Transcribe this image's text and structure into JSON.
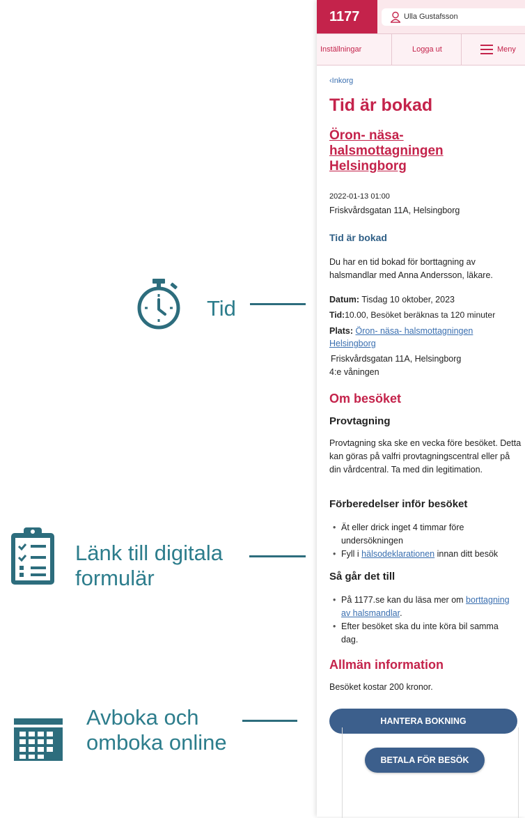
{
  "annotations": [
    {
      "label": "Tid",
      "icon": "stopwatch-icon"
    },
    {
      "label_line1": "Länk till digitala",
      "label_line2": "formulär",
      "icon": "clipboard-checklist-icon"
    },
    {
      "label_line1": "Avboka och",
      "label_line2": "omboka online",
      "icon": "calendar-icon"
    }
  ],
  "header": {
    "logo": "1177",
    "user_name": "Ulla Gustafsson",
    "nav": {
      "settings": "Inställningar",
      "logout": "Logga ut",
      "menu": "Meny"
    }
  },
  "message": {
    "back_link": "Inkorg",
    "title": "Tid är bokad",
    "clinic_name": "Öron- näsa- halsmottagningen Helsingborg",
    "datetime": "2022-01-13 01:00",
    "address": "Friskvårdsgatan 11A, Helsingborg",
    "subheading": "Tid är bokad",
    "intro": "Du har en tid bokad för borttagning av halsmandlar med Anna Andersson, läkare.",
    "date_label": "Datum:",
    "date_value": "Tisdag 10 oktober, 2023",
    "time_label": "Tid:",
    "time_value": "10.00, Besöket beräknas ta 120 minuter",
    "place_label": "Plats:",
    "place_link": "Öron- näsa- halsmottagningen Helsingborg",
    "place_address": "Friskvårdsgatan 11A, Helsingborg",
    "place_floor": "4:e våningen",
    "about_heading": "Om besöket",
    "sample_heading": "Provtagning",
    "sample_text": "Provtagning ska ske en vecka före besöket. Detta kan göras på valfri provtagningscentral eller på din vårdcentral. Ta med din legitimation.",
    "prep_heading": "Förberedelser inför besöket",
    "prep_item1": "Ät eller drick inget 4 timmar före undersökningen",
    "prep_item2_pre": "Fyll i ",
    "prep_item2_link": "hälsodeklarationen",
    "prep_item2_post": " innan ditt besök",
    "how_heading": "Så går det till",
    "how_item1_pre": "På 1177.se kan du läsa mer om ",
    "how_item1_link": "borttagning av halsmandlar",
    "how_item1_post": ".",
    "how_item2": "Efter besöket ska du inte köra bil samma dag.",
    "general_heading": "Allmän information",
    "cost": "Besöket kostar 200 kronor.",
    "manage_button": "HANTERA BOKNING",
    "pay_button": "BETALA FÖR BESÖK"
  },
  "colors": {
    "brand_red": "#c4234b",
    "teal": "#2d7d8c",
    "button_blue": "#3c5f8c",
    "link_blue": "#3a6fb0"
  }
}
